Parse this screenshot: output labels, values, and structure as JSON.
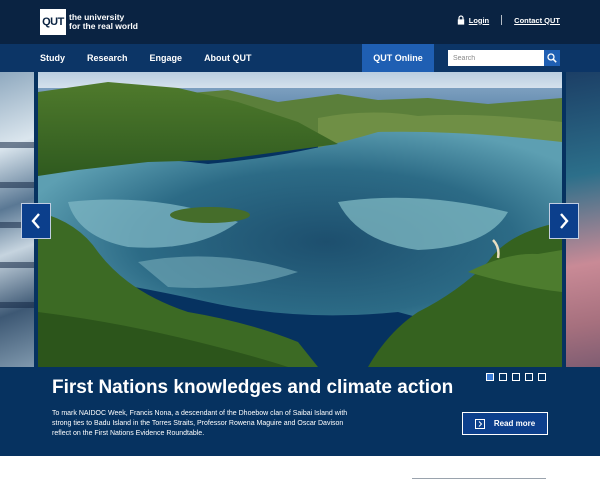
{
  "header": {
    "logo_mark": "QUT",
    "logo_tagline_line1": "the university",
    "logo_tagline_line2": "for the real world",
    "login_label": "Login",
    "contact_label": "Contact QUT"
  },
  "nav": {
    "items": [
      {
        "label": "Study"
      },
      {
        "label": "Research"
      },
      {
        "label": "Engage"
      },
      {
        "label": "About QUT"
      }
    ],
    "online_label": "QUT Online",
    "search_placeholder": "Search"
  },
  "hero": {
    "title": "First Nations knowledges and climate action",
    "description": "To mark NAIDOC Week, Francis Nona, a descendant of the Dhoebow clan of Saibai Island with strong ties to Badu Island in the Torres Straits, Professor Rowena Maguire and Oscar Davison reflect on the First Nations Evidence Roundtable.",
    "read_more_label": "Read more",
    "slide_count": 5,
    "active_slide": 1
  },
  "colors": {
    "header_bg": "#0a2342",
    "nav_bg": "#0c3566",
    "accent_blue": "#1f5fb3",
    "caption_bg": "#063260"
  },
  "icons": {
    "login": "lock-icon",
    "search": "search-icon",
    "prev": "chevron-left-icon",
    "next": "chevron-right-icon",
    "read_more": "chevron-right-box-icon"
  }
}
